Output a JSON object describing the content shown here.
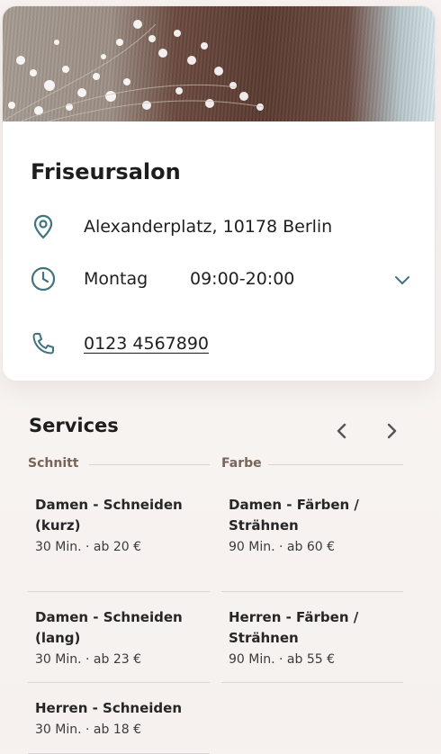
{
  "salon": {
    "name": "Friseursalon",
    "address": "Alexanderplatz, 10178 Berlin",
    "hours": {
      "day": "Montag",
      "time": "09:00-20:00"
    },
    "phone": "0123 4567890"
  },
  "icons": {
    "location": "map-pin-icon",
    "hours": "clock-icon",
    "expand": "chevron-down-icon",
    "phone": "phone-icon",
    "prev": "chevron-left-icon",
    "next": "chevron-right-icon"
  },
  "colors": {
    "accent": "#3f7380",
    "category": "#7a6358",
    "divider": "#ddd5d1"
  },
  "services": {
    "title": "Services",
    "columns": [
      {
        "category": "Schnitt",
        "items": [
          {
            "name": "Damen - Schneiden (kurz)",
            "meta": "30 Min. · ab 20 €"
          },
          {
            "name": "Damen - Schneiden (lang)",
            "meta": "30 Min. · ab 23 €"
          },
          {
            "name": "Herren - Schneiden",
            "meta": "30 Min. · ab 18 €"
          }
        ]
      },
      {
        "category": "Farbe",
        "items": [
          {
            "name": "Damen - Färben / Strähnen",
            "meta": "90 Min. · ab 60 €"
          },
          {
            "name": "Herren - Färben / Strähnen",
            "meta": "90 Min. · ab 55 €"
          }
        ]
      }
    ]
  }
}
